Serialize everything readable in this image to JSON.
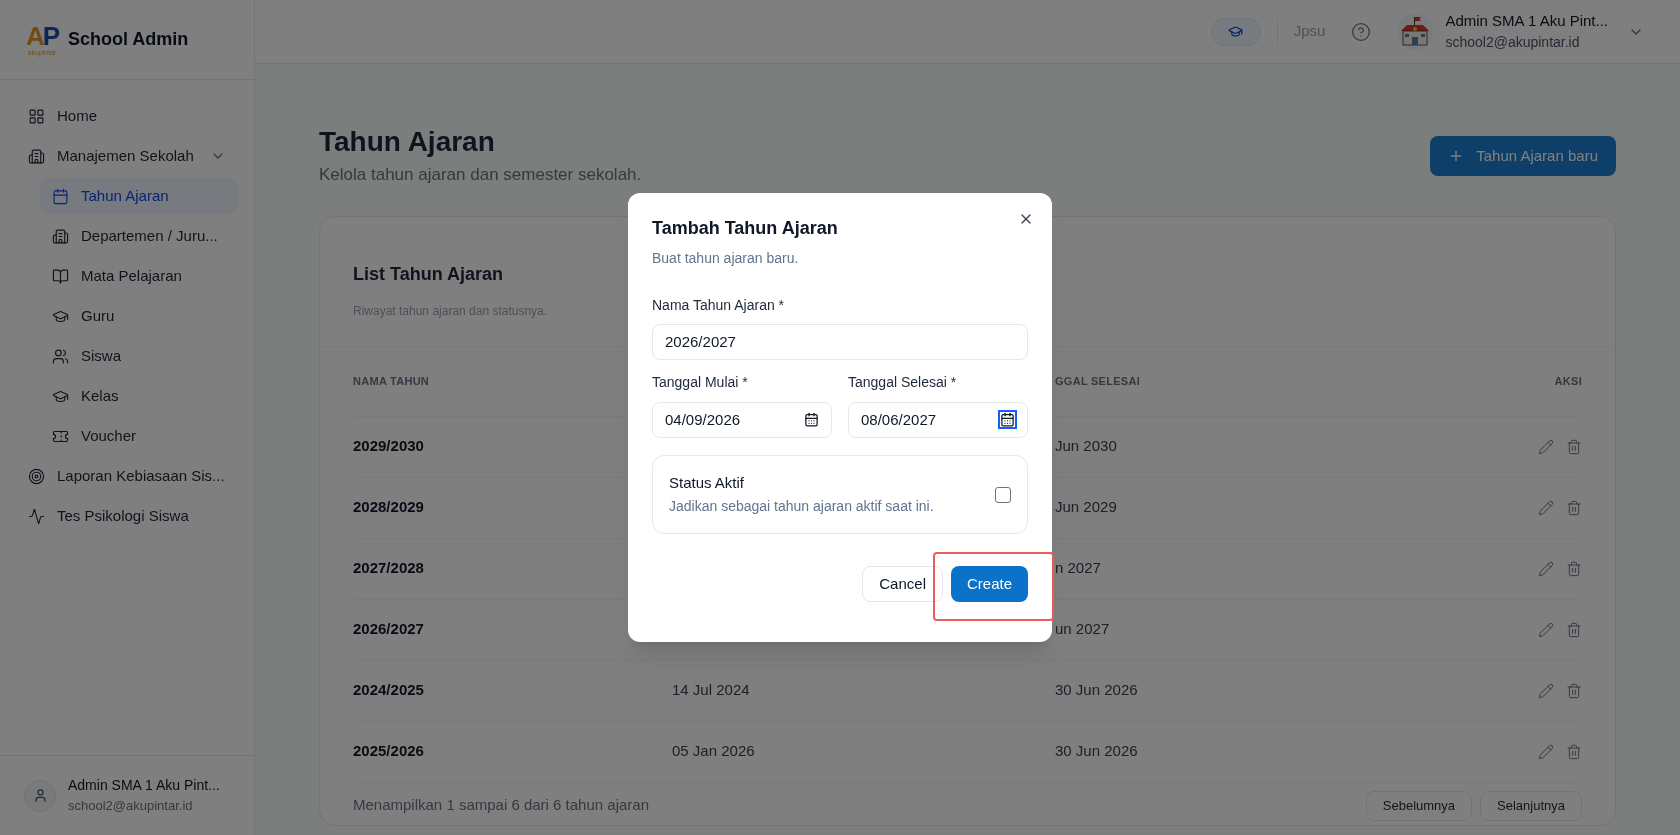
{
  "sidebar": {
    "logo": {
      "letters": "AP",
      "caption": "akupintar"
    },
    "brand": "School Admin",
    "items": [
      {
        "label": "Home",
        "selected": false
      },
      {
        "label": "Manajemen Sekolah",
        "selected": false,
        "expanded": true,
        "children": [
          {
            "label": "Tahun Ajaran",
            "selected": true
          },
          {
            "label": "Departemen / Juru...",
            "selected": false
          },
          {
            "label": "Mata Pelajaran",
            "selected": false
          },
          {
            "label": "Guru",
            "selected": false
          },
          {
            "label": "Siswa",
            "selected": false
          },
          {
            "label": "Kelas",
            "selected": false
          },
          {
            "label": "Voucher",
            "selected": false
          }
        ]
      },
      {
        "label": "Laporan Kebiasaan Sis...",
        "selected": false
      },
      {
        "label": "Tes Psikologi Siswa",
        "selected": false
      }
    ],
    "user": {
      "name": "Admin SMA 1 Aku Pint...",
      "email": "school2@akupintar.id"
    }
  },
  "header": {
    "school_code": "Jpsu",
    "user": {
      "name": "Admin SMA 1 Aku Pint...",
      "email": "school2@akupintar.id"
    }
  },
  "page": {
    "title": "Tahun Ajaran",
    "subtitle": "Kelola tahun ajaran dan semester sekolah.",
    "new_button": "Tahun Ajaran baru"
  },
  "card": {
    "title": "List Tahun Ajaran",
    "subtitle": "Riwayat tahun ajaran dan statusnya.",
    "columns": [
      "NAMA TAHUN",
      "",
      "GGAL SELESAI",
      "AKSI"
    ],
    "rows": [
      {
        "name": "2029/2030",
        "end": "Jun 2030"
      },
      {
        "name": "2028/2029",
        "end": "Jun 2029"
      },
      {
        "name": "2027/2028",
        "end": "n 2027"
      },
      {
        "name": "2026/2027",
        "end": "un 2027"
      },
      {
        "name": "2024/2025",
        "start": "14 Jul 2024",
        "end": "30 Jun 2026"
      },
      {
        "name": "2025/2026",
        "start": "05 Jan 2026",
        "end": "30 Jun 2026"
      }
    ],
    "footer": "Menampilkan 1 sampai 6 dari 6 tahun ajaran",
    "pagination": [
      "Sebelumnya",
      "Selanjutnya"
    ]
  },
  "modal": {
    "title": "Tambah Tahun Ajaran",
    "subtitle": "Buat tahun ajaran baru.",
    "name_field": {
      "label": "Nama Tahun Ajaran *",
      "value": "2026/2027"
    },
    "date_fields": [
      {
        "label": "Tanggal Mulai *",
        "value": "04/09/2026",
        "focused": false
      },
      {
        "label": "Tanggal Selesai *",
        "value": "08/06/2027",
        "focused": true
      }
    ],
    "status": {
      "title": "Status Aktif",
      "description": "Jadikan sebagai tahun ajaran aktif saat ini.",
      "checked": false
    },
    "buttons": [
      {
        "label": "Cancel",
        "kind": "secondary"
      },
      {
        "label": "Create",
        "kind": "primary",
        "highlighted": true
      }
    ]
  }
}
